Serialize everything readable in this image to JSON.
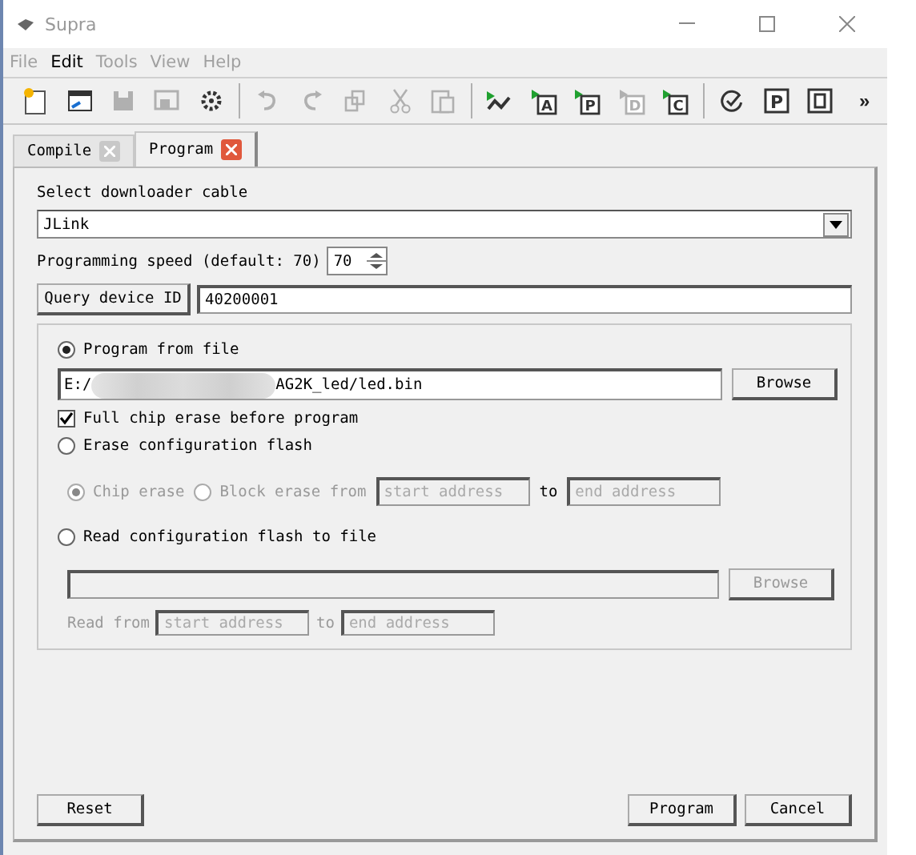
{
  "window": {
    "title": "Supra"
  },
  "menu": [
    {
      "label": "File",
      "disabled": true
    },
    {
      "label": "Edit",
      "disabled": false
    },
    {
      "label": "Tools",
      "disabled": true
    },
    {
      "label": "View",
      "disabled": true
    },
    {
      "label": "Help",
      "disabled": true
    }
  ],
  "toolbar": [
    {
      "kind": "new",
      "disabled": false
    },
    {
      "kind": "open",
      "disabled": false
    },
    {
      "kind": "save",
      "disabled": true
    },
    {
      "kind": "save-all",
      "disabled": true
    },
    {
      "kind": "settings",
      "disabled": false
    },
    {
      "kind": "separator"
    },
    {
      "kind": "undo",
      "disabled": true
    },
    {
      "kind": "redo",
      "disabled": true
    },
    {
      "kind": "copy",
      "disabled": true
    },
    {
      "kind": "cut",
      "disabled": true
    },
    {
      "kind": "paste",
      "disabled": true
    },
    {
      "kind": "separator"
    },
    {
      "kind": "flow",
      "disabled": false
    },
    {
      "kind": "run",
      "letter": "A",
      "disabled": false
    },
    {
      "kind": "run",
      "letter": "P",
      "disabled": false
    },
    {
      "kind": "run",
      "letter": "D",
      "disabled": true
    },
    {
      "kind": "run",
      "letter": "C",
      "disabled": false
    },
    {
      "kind": "separator"
    },
    {
      "kind": "check",
      "disabled": false
    },
    {
      "kind": "board",
      "letter": "P",
      "disabled": false
    },
    {
      "kind": "chip",
      "disabled": false
    },
    {
      "kind": "more",
      "label": "»"
    }
  ],
  "tabs": [
    {
      "label": "Compile",
      "selected": false
    },
    {
      "label": "Program",
      "selected": true
    }
  ],
  "cable": {
    "label": "Select downloader cable",
    "value": "JLink"
  },
  "speed": {
    "label": "Programming speed (default: 70)",
    "value": "70"
  },
  "device": {
    "button": "Query device ID",
    "value": "40200001"
  },
  "options": {
    "program_from_file": {
      "label": "Program from file",
      "selected": true,
      "path_start": "E:/",
      "path_end": "AG2K_led/led.bin",
      "browse": "Browse"
    },
    "full_chip_erase": {
      "label": "Full chip erase before program",
      "checked": true
    },
    "erase_flash": {
      "label": "Erase configuration flash",
      "selected": false,
      "modes": [
        {
          "label": "Chip erase",
          "selected": true
        },
        {
          "label": "Block erase from",
          "selected": false
        }
      ],
      "start_placeholder": "start address",
      "to": "to",
      "end_placeholder": "end address"
    },
    "read_flash": {
      "label": "Read configuration flash to file",
      "selected": false,
      "browse": "Browse",
      "read_from": "Read from",
      "start_placeholder": "start address",
      "to": "to",
      "end_placeholder": "end address"
    }
  },
  "buttons": {
    "reset": "Reset",
    "program": "Program",
    "cancel": "Cancel"
  }
}
